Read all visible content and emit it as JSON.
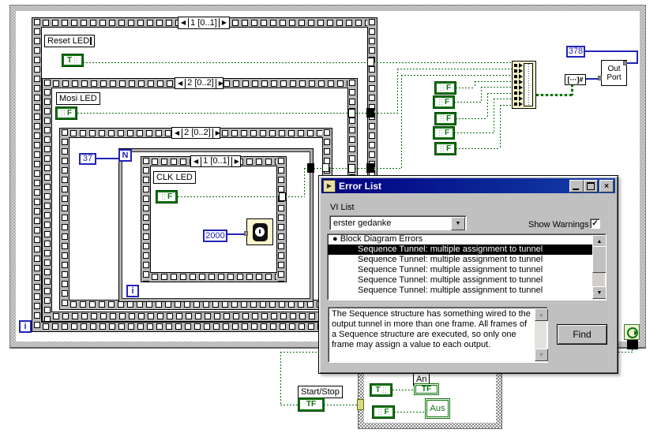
{
  "diagram": {
    "frames": {
      "seq1": "1 [0..1]",
      "seq2": "2 [0..2]",
      "seq3": "2 [0..2]",
      "seq4": "1 [0..1]"
    },
    "labels": {
      "reset": "Reset LED",
      "mosi": "Mosi LED",
      "clk": "CLK LED",
      "start_stop": "Start/Stop",
      "an": "An",
      "aus": "Aus"
    },
    "constants": {
      "count": "37",
      "wait_ms": "2000",
      "port_addr": "378"
    },
    "terminals": {
      "n": "N",
      "i": "i",
      "i_outer": "i",
      "t": "T",
      "f": "F",
      "tf": "TF"
    },
    "nodes": {
      "out_port": "Out Port",
      "bool_array_to_number": "[···]#"
    }
  },
  "error_window": {
    "title": "Error List",
    "vi_list_label": "VI List",
    "vi_name": "erster gedanke",
    "show_warnings": "Show Warnings",
    "list_header": "Block Diagram Errors",
    "errors": [
      "Sequence Tunnel: multiple assignment to tunnel",
      "Sequence Tunnel: multiple assignment to tunnel",
      "Sequence Tunnel: multiple assignment to tunnel",
      "Sequence Tunnel: multiple assignment to tunnel",
      "Sequence Tunnel: multiple assignment to tunnel"
    ],
    "description": "The Sequence structure has something wired to the output tunnel in more than one frame. All frames of a Sequence structure are executed, so only one frame may assign a value to each output.",
    "find_button": "Find"
  },
  "icons": {
    "left_arrow": "◀",
    "right_arrow": "▶",
    "up_arrow": "▲",
    "down_arrow": "▼",
    "check": "✓",
    "close": "×",
    "bullet": "●",
    "run_arrow": "▶"
  },
  "colors": {
    "wire_green": "#0c6e0c",
    "wire_blue": "#2323b8",
    "titlebar": "#000080",
    "selection": "#000000",
    "structure_gray": "#b8b8b8",
    "function_yellow": "#fbf6cd"
  }
}
